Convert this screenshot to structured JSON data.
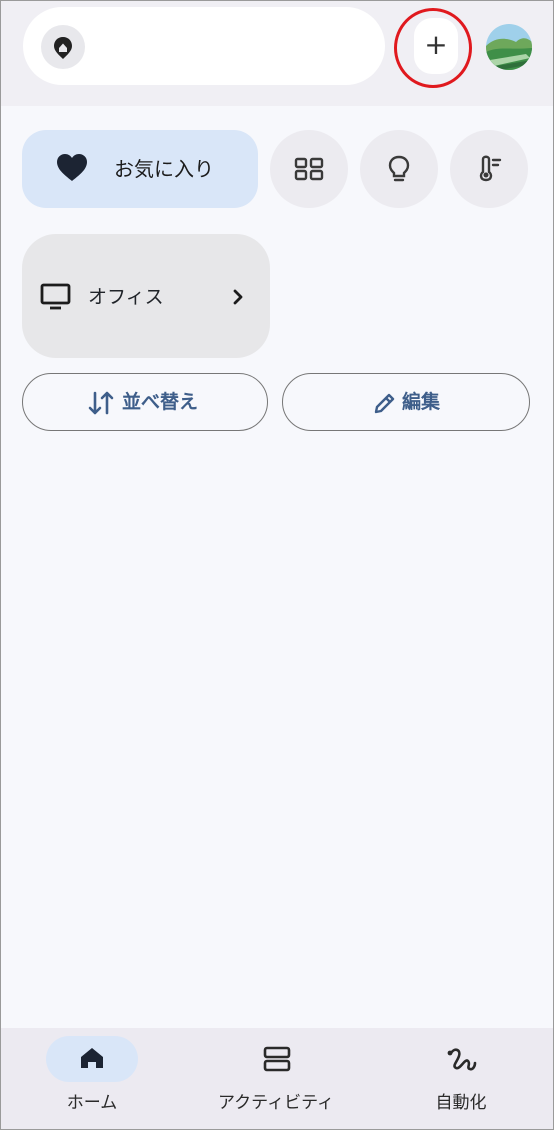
{
  "header": {
    "add_label": "+"
  },
  "chips": {
    "favorites_label": "お気に入り"
  },
  "room": {
    "name": "オフィス",
    "chevron": "›"
  },
  "actions": {
    "sort_label": "並べ替え",
    "edit_label": "編集"
  },
  "nav": {
    "items": [
      {
        "label": "ホーム",
        "icon": "home-icon",
        "active": true
      },
      {
        "label": "アクティビティ",
        "icon": "activity-icon",
        "active": false
      },
      {
        "label": "自動化",
        "icon": "automation-icon",
        "active": false
      }
    ]
  },
  "colors": {
    "accent": "#d9e6f8",
    "highlight_ring": "#e0191e",
    "action_text": "#3e5e8a"
  }
}
